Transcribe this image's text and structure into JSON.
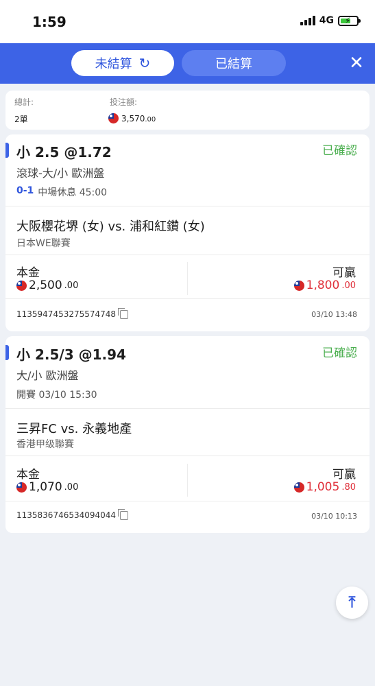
{
  "status_bar": {
    "time": "1:59",
    "network": "4G"
  },
  "tabs": {
    "unsettled": "未結算",
    "settled": "已結算"
  },
  "summary": {
    "total_label": "總計:",
    "total_value": "2單",
    "stake_label": "投注額:",
    "stake_int": "3,570",
    "stake_dec": ".00"
  },
  "bets": [
    {
      "title": "小 2.5 @1.72",
      "status": "已確認",
      "type": "滾球-大/小 歐洲盤",
      "score": "0-1",
      "info": "中場休息 45:00",
      "match": "大阪櫻花堺 (女) vs. 浦和紅鑽 (女)",
      "league": "日本WE聯賽",
      "stake_label": "本金",
      "stake_int": "2,500",
      "stake_dec": ".00",
      "win_label": "可贏",
      "win_int": "1,800",
      "win_dec": ".00",
      "bet_id": "1135947453275574748",
      "time": "03/10 13:48"
    },
    {
      "title": "小 2.5/3 @1.94",
      "status": "已確認",
      "type": "大/小 歐洲盤",
      "score": "",
      "info": "開賽 03/10 15:30",
      "match": "三昇FC vs. 永義地產",
      "league": "香港甲级聯賽",
      "stake_label": "本金",
      "stake_int": "1,070",
      "stake_dec": ".00",
      "win_label": "可贏",
      "win_int": "1,005",
      "win_dec": ".80",
      "bet_id": "1135836746534094044",
      "time": "03/10 10:13"
    }
  ],
  "icons": {
    "refresh": "refresh-icon",
    "close": "close-icon",
    "copy": "copy-icon",
    "flag": "taiwan-flag-icon",
    "scroll_top": "scroll-top-icon"
  },
  "colors": {
    "header": "#3d63e6",
    "accent": "#2f55dd",
    "confirmed": "#4caf50",
    "win": "#e0303a"
  }
}
